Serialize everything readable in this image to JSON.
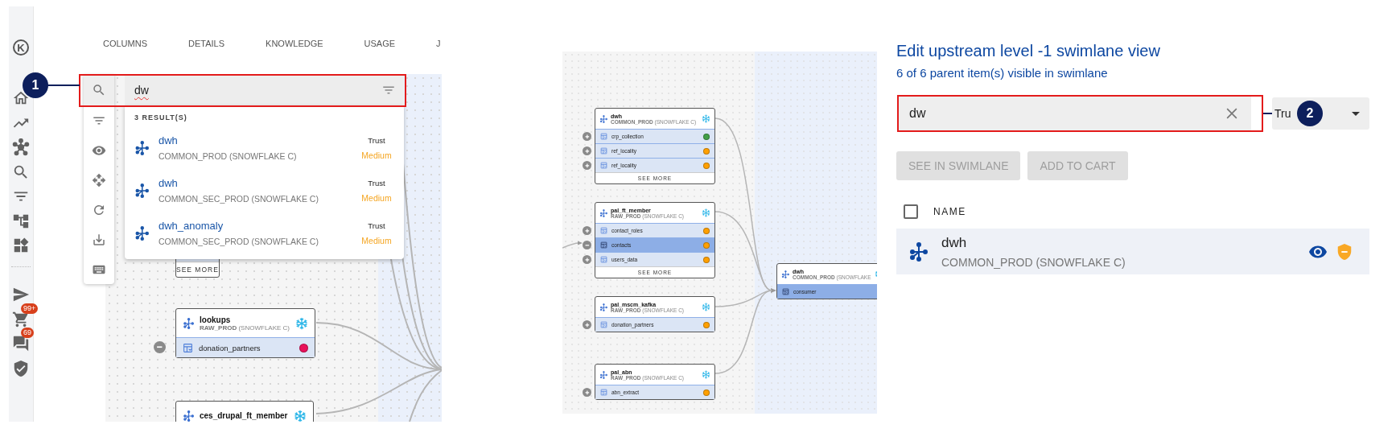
{
  "left_screen": {
    "rail": {
      "logo_letter": "K",
      "cart_badge": "99+",
      "comments_badge": "69"
    },
    "tabs": [
      {
        "label": "COLUMNS",
        "selected": false
      },
      {
        "label": "DETAILS",
        "selected": false
      },
      {
        "label": "KNOWLEDGE",
        "selected": false
      },
      {
        "label": "USAGE",
        "selected": false
      },
      {
        "label": "J",
        "selected": false
      }
    ],
    "callout": "1",
    "search": {
      "value": "dw"
    },
    "results": {
      "count": "3 RESULT(S)",
      "items": [
        {
          "name": "dwh",
          "source": "COMMON_PROD (SNOWFLAKE C)",
          "trust_label": "Trust",
          "trust": "Medium"
        },
        {
          "name": "dwh",
          "source": "COMMON_SEC_PROD (SNOWFLAKE C)",
          "trust_label": "Trust",
          "trust": "Medium"
        },
        {
          "name": "dwh_anomaly",
          "source": "COMMON_SEC_PROD (SNOWFLAKE C)",
          "trust_label": "Trust",
          "trust": "Medium"
        }
      ]
    },
    "nodes": [
      {
        "kind": "covered",
        "see_more": "SEE MORE"
      },
      {
        "kind": "node",
        "name": "lookups",
        "source": "**RAW_PROD** (SNOWFLAKE C)",
        "columns": [
          {
            "name": "donation_partners",
            "color": "#e8115b",
            "expanded": true,
            "selected": false
          }
        ]
      },
      {
        "kind": "cut",
        "name": "ces_drupal_ft_member"
      }
    ]
  },
  "right_screen": {
    "graph": {
      "nodes": [
        {
          "name": "dwh",
          "source": "**COMMON_PROD** (SNOWFLAKE C)",
          "columns": [
            {
              "name": "crp_collection",
              "color": "#43a047",
              "expanded": false,
              "selected": false
            },
            {
              "name": "ref_locality",
              "color": "#ffa000",
              "expanded": false,
              "selected": false
            },
            {
              "name": "ref_locality",
              "color": "#ffa000",
              "expanded": false,
              "selected": false
            }
          ],
          "see_more": "SEE MORE"
        },
        {
          "name": "pal_ft_member",
          "source": "**RAW_PROD** (SNOWFLAKE C)",
          "columns": [
            {
              "name": "contact_roles",
              "color": "#ffa000",
              "expanded": false,
              "selected": false
            },
            {
              "name": "contacts",
              "color": "#ffa000",
              "expanded": true,
              "selected": true
            },
            {
              "name": "users_data",
              "color": "#ffa000",
              "expanded": false,
              "selected": false
            }
          ],
          "see_more": "SEE MORE"
        },
        {
          "name": "pal_mscm_kafka",
          "source": "**RAW_PROD** (SNOWFLAKE C)",
          "columns": [
            {
              "name": "donation_partners",
              "color": "#ffa000",
              "expanded": false,
              "selected": false
            }
          ]
        },
        {
          "name": "pal_abn",
          "source": "**RAW_PROD** (SNOWFLAKE C)",
          "columns": [
            {
              "name": "abn_extract",
              "color": "#ffa000",
              "expanded": false,
              "selected": false
            }
          ]
        }
      ],
      "target": {
        "name": "dwh",
        "source": "**COMMON_PROD** (SNOWFLAKE",
        "columns": [
          {
            "name": "consumer",
            "selected": true
          }
        ]
      }
    },
    "panel": {
      "title": "Edit upstream level -1 swimlane view",
      "subtitle": "6 of 6 parent item(s) visible in swimlane",
      "search": {
        "value": "dw"
      },
      "filter": {
        "value": "Tru"
      },
      "callout": "2",
      "buttons": [
        {
          "label": "SEE IN SWIMLANE",
          "disabled": true
        },
        {
          "label": "ADD TO CART",
          "disabled": true
        }
      ],
      "table": {
        "select_all_checked": false,
        "columns": [
          "NAME"
        ],
        "rows": [
          {
            "name": "dwh",
            "source": "COMMON_PROD (SNOWFLAKE C)"
          }
        ]
      }
    }
  }
}
